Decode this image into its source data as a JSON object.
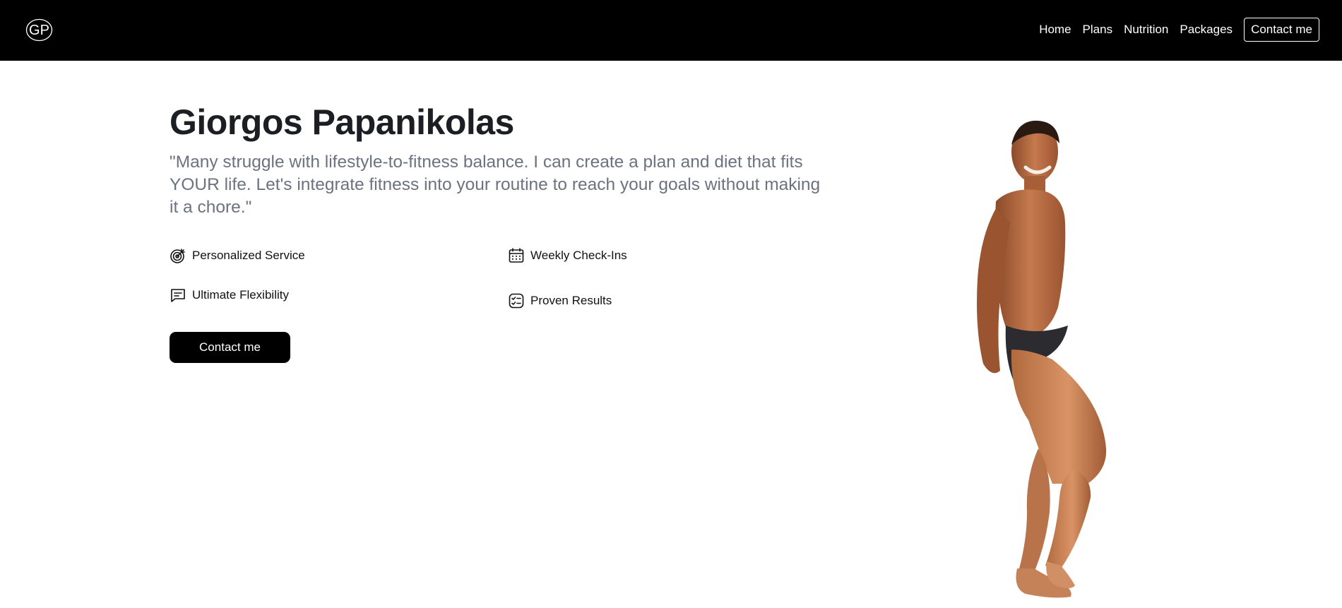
{
  "nav": {
    "logo_text": "GP",
    "links": [
      "Home",
      "Plans",
      "Nutrition",
      "Packages"
    ],
    "contact_label": "Contact me"
  },
  "hero": {
    "title": "Giorgos Papanikolas",
    "quote": "\"Many struggle with lifestyle-to-fitness balance. I can create a plan and diet that fits YOUR life. Let's integrate fitness into your routine to reach your goals without making it a chore.\"",
    "features": [
      {
        "label": "Personalized Service",
        "icon": "target-icon"
      },
      {
        "label": "Weekly Check-Ins",
        "icon": "calendar-icon"
      },
      {
        "label": "Ultimate Flexibility",
        "icon": "message-icon"
      },
      {
        "label": "Proven Results",
        "icon": "checklist-icon"
      }
    ],
    "cta_label": "Contact me"
  },
  "colors": {
    "navbar_bg": "#000000",
    "title": "#1b1f23",
    "quote": "#6b7280",
    "cta_bg": "#000000"
  }
}
